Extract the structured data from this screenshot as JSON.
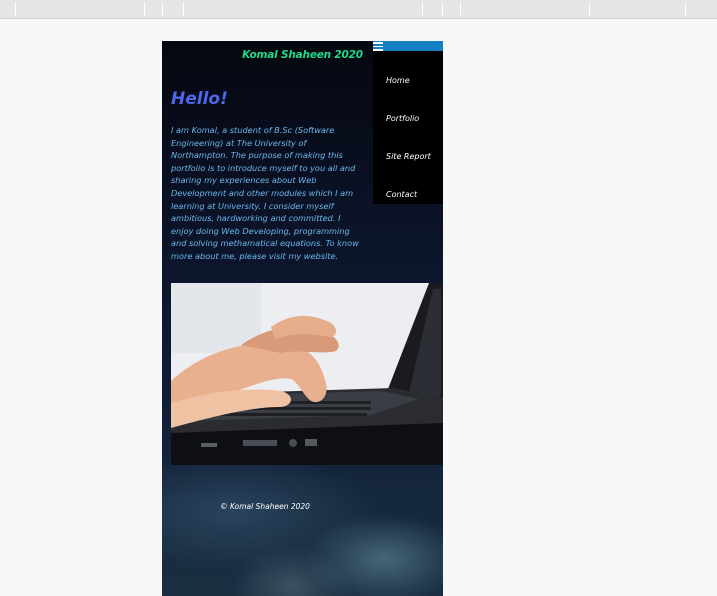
{
  "site": {
    "title": "Komal Shaheen 2020",
    "greeting": "Hello!",
    "intro": "I am Komal, a student of B.Sc (Software Engineering) at The University of Northampton. The purpose of making this portfolio is to introduce myself to you all and sharing my experiences about Web Development and other modules which I am learning at University. I consider myself ambitious, hardworking and committed. I enjoy doing Web Developing, programming and solving methamatical equations. To know more about me, please visit my website.",
    "footer": "© Komal Shaheen 2020"
  },
  "nav": {
    "items": [
      {
        "label": "Home"
      },
      {
        "label": "Portfolio"
      },
      {
        "label": "Site Report"
      },
      {
        "label": "Contact"
      }
    ]
  },
  "image": {
    "icon": "laptop-typing-photo"
  },
  "colors": {
    "title": "#1ddb8a",
    "greeting": "#4d66ea",
    "intro": "#6ab8ec",
    "menu_toggle": "#1681c2",
    "nav_bg": "#000000"
  }
}
